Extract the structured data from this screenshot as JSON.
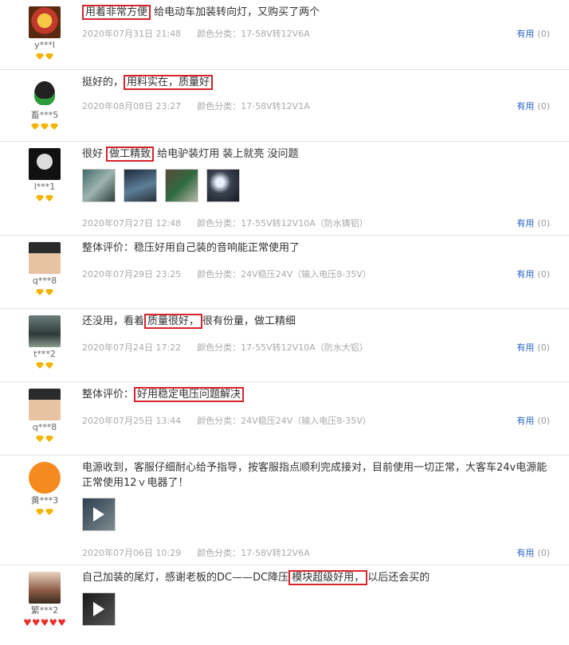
{
  "reviews": [
    {
      "user": "y***l",
      "text_pre": "",
      "highlight": "用着非常方便",
      "text_post": "  给电动车加装转向灯，又购买了两个",
      "date": "2020年07月31日 21:48",
      "spec": "颜色分类：17-58V转12V6A",
      "useful_label": "有用",
      "useful_count": "(0)"
    },
    {
      "user": "畜***5",
      "text_pre": "挺好的，",
      "highlight": "用料实在，质量好",
      "text_post": "",
      "date": "2020年08月08日 23:27",
      "spec": "颜色分类：17-58V转12V1A",
      "useful_label": "有用",
      "useful_count": "(0)"
    },
    {
      "user": "l***1",
      "text_pre": "很好 ",
      "highlight": "做工精致",
      "text_post": " 给电驴装灯用 装上就亮 没问题",
      "date": "2020年07月27日 12:48",
      "spec": "颜色分类：17-55V转12V10A（防水铸铝）",
      "useful_label": "有用",
      "useful_count": "(0)"
    },
    {
      "user": "q***8",
      "text_pre": "整体评价：稳压好用自己装的音响能正常使用了",
      "highlight": "",
      "text_post": "",
      "date": "2020年07月29日 23:25",
      "spec": "颜色分类：24V稳压24V（输入电压8-35V）",
      "useful_label": "有用",
      "useful_count": "(0)"
    },
    {
      "user": "t***2",
      "text_pre": "还没用，看着",
      "highlight": "质量很好，",
      "text_post": "很有份量，做工精细",
      "date": "2020年07月24日 17:22",
      "spec": "颜色分类：17-55V转12V10A（防水大铝）",
      "useful_label": "有用",
      "useful_count": "(0)"
    },
    {
      "user": "q***8",
      "text_pre": "整体评价：",
      "highlight": "好用稳定电压问题解决",
      "text_post": "",
      "date": "2020年07月25日 13:44",
      "spec": "颜色分类：24V稳压24V（输入电压8-35V）",
      "useful_label": "有用",
      "useful_count": "(0)"
    },
    {
      "user": "黄***3",
      "text_pre": "电源收到，客服仔细耐心给予指导，按客服指点顺利完成接对，目前使用一切正常，大客车24v电源能正常使用12ｖ电器了！",
      "highlight": "",
      "text_post": "",
      "date": "2020年07月06日 10:29",
      "spec": "颜色分类：17-58V转12V6A",
      "useful_label": "有用",
      "useful_count": "(0)"
    },
    {
      "user": "繁***2",
      "text_pre": "自己加装的尾灯，感谢老板的DC——DC降压",
      "highlight": "模块超级好用，",
      "text_post": "以后还会买的",
      "date": "",
      "spec": "",
      "useful_label": "",
      "useful_count": ""
    }
  ]
}
